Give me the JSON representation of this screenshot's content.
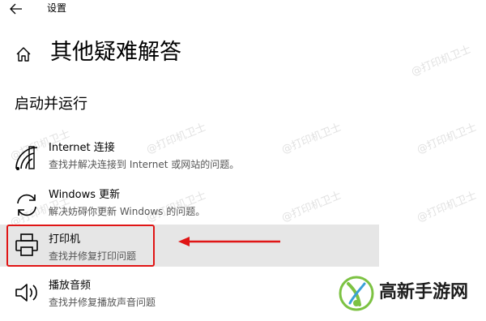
{
  "window": {
    "title": "设置"
  },
  "page": {
    "title": "其他疑难解答"
  },
  "section": {
    "title": "启动并运行"
  },
  "items": [
    {
      "name": "Internet 连接",
      "desc": "查找并解决连接到 Internet 或网站的问题。",
      "icon": "wifi-icon"
    },
    {
      "name": "Windows 更新",
      "desc": "解决妨碍你更新 Windows 的问题。",
      "icon": "refresh-icon"
    },
    {
      "name": "打印机",
      "desc": "查找并修复打印问题",
      "icon": "printer-icon"
    },
    {
      "name": "播放音频",
      "desc": "查找并修复播放声音问题",
      "icon": "speaker-icon"
    }
  ],
  "watermark": {
    "text": "@打印机卫士"
  },
  "brand": {
    "text": "高新手游网"
  },
  "colors": {
    "highlight": "#e01515",
    "selected_bg": "#e6e6e6",
    "brand_green": "#7cc242"
  }
}
